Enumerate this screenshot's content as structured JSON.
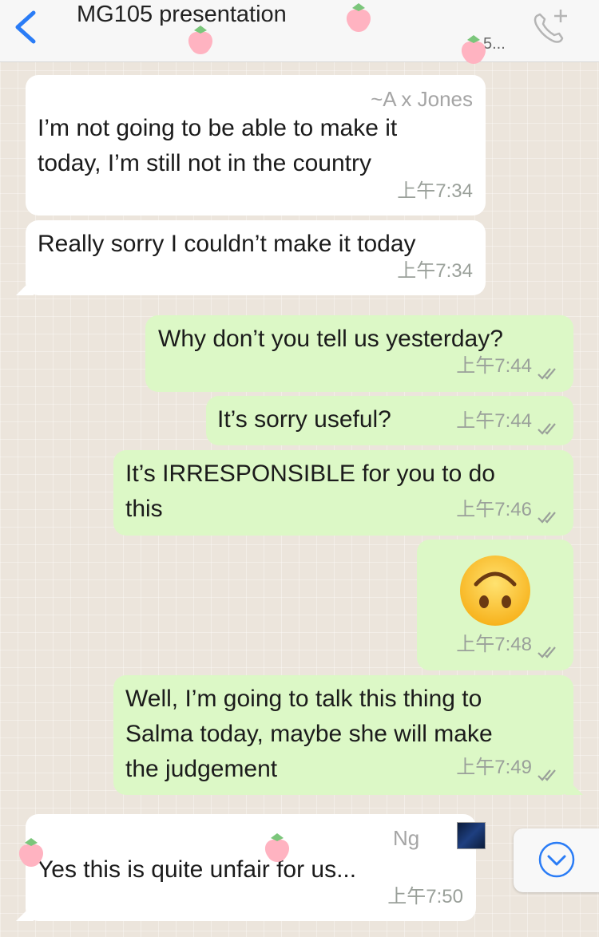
{
  "header": {
    "back_icon": "chevron-left-icon",
    "title": "MG105 presentation",
    "subtitle": "5...",
    "call_icon": "phone-plus-icon"
  },
  "messages": [
    {
      "direction": "in",
      "sender": "~A    x Jones",
      "lines": [
        "I’m not going to be able to make it",
        "today, I’m still not in the country"
      ],
      "time": "上午7:34"
    },
    {
      "direction": "in",
      "lines": [
        "Really sorry I couldn’t make it today"
      ],
      "time": "上午7:34"
    },
    {
      "direction": "out",
      "lines": [
        "Why don’t you tell us yesterday?"
      ],
      "time": "上午7:44",
      "status": "read-double-check"
    },
    {
      "direction": "out",
      "lines": [
        "It’s sorry useful?"
      ],
      "time": "上午7:44",
      "status": "read-double-check"
    },
    {
      "direction": "out",
      "lines": [
        "It’s IRRESPONSIBLE for you to do",
        "this"
      ],
      "time": "上午7:46",
      "status": "read-double-check"
    },
    {
      "direction": "out",
      "emoji": "upside-down-face-icon",
      "time": "上午7:48",
      "status": "read-double-check"
    },
    {
      "direction": "out",
      "lines": [
        "Well, I’m going to talk this thing to",
        "Salma today, maybe she will make",
        "the judgement"
      ],
      "time": "上午7:49",
      "status": "read-double-check"
    },
    {
      "direction": "in",
      "sender": "Ng",
      "lines": [
        "Yes this is quite unfair for us..."
      ],
      "time": "上午7:50"
    }
  ],
  "scroll_button": {
    "icon": "chevron-down-circle-icon"
  },
  "colors": {
    "incoming_bubble": "#ffffff",
    "outgoing_bubble": "#dcf8c6",
    "wallpaper": "#ece5dc",
    "accent_blue": "#2a7cf6",
    "tick_grey": "#9aa09a"
  }
}
